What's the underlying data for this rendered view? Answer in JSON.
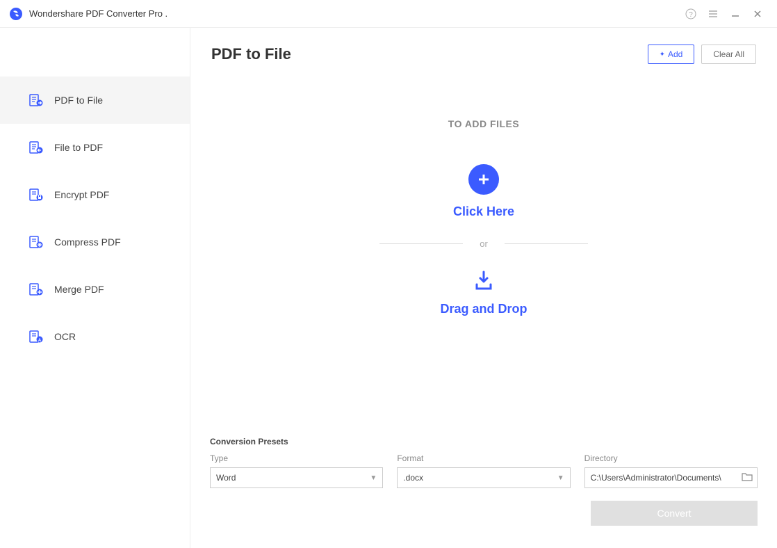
{
  "app": {
    "title": "Wondershare PDF Converter Pro ."
  },
  "header": {
    "title": "PDF to File",
    "add_label": "Add",
    "clear_label": "Clear All"
  },
  "sidebar": {
    "items": [
      {
        "label": "PDF to File",
        "icon": "pdf-to-file-icon",
        "active": true
      },
      {
        "label": "File to PDF",
        "icon": "file-to-pdf-icon",
        "active": false
      },
      {
        "label": "Encrypt PDF",
        "icon": "encrypt-pdf-icon",
        "active": false
      },
      {
        "label": "Compress PDF",
        "icon": "compress-pdf-icon",
        "active": false
      },
      {
        "label": "Merge PDF",
        "icon": "merge-pdf-icon",
        "active": false
      },
      {
        "label": "OCR",
        "icon": "ocr-icon",
        "active": false
      }
    ]
  },
  "dropzone": {
    "heading": "TO ADD FILES",
    "click_label": "Click Here",
    "or_label": "or",
    "drag_label": "Drag and Drop"
  },
  "presets": {
    "title": "Conversion Presets",
    "type_label": "Type",
    "type_value": "Word",
    "format_label": "Format",
    "format_value": ".docx",
    "directory_label": "Directory",
    "directory_value": "C:\\Users\\Administrator\\Documents\\",
    "convert_label": "Convert"
  },
  "colors": {
    "accent": "#3b5bff"
  }
}
